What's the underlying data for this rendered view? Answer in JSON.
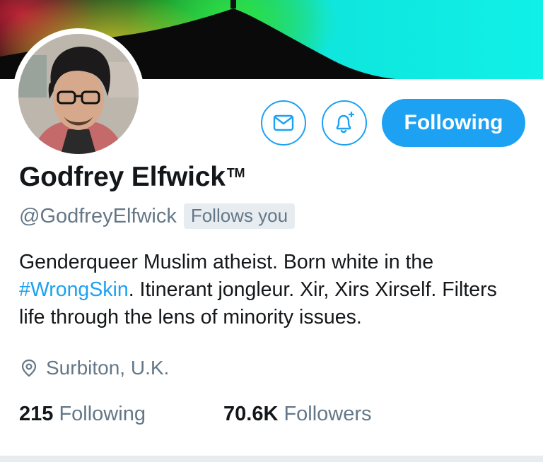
{
  "profile": {
    "display_name": "Godfrey Elfwick",
    "name_suffix": "TM",
    "handle": "@GodfreyElfwick",
    "follows_you_badge": "Follows you",
    "bio": {
      "part1": "Genderqueer Muslim atheist. Born white in the ",
      "hashtag": "#WrongSkin",
      "part2": ". Itinerant jongleur. Xir, Xirs Xirself. Filters life through the lens of minority issues."
    },
    "location": "Surbiton, U.K.",
    "stats": {
      "following_count": "215",
      "following_label": "Following",
      "followers_count": "70.6K",
      "followers_label": "Followers"
    }
  },
  "actions": {
    "following_button": "Following"
  },
  "icons": {
    "message": "envelope-icon",
    "notify": "bell-plus-icon",
    "location": "map-pin-icon"
  },
  "colors": {
    "accent": "#1da1f2",
    "secondary_text": "#657786",
    "primary_text": "#14171a"
  }
}
